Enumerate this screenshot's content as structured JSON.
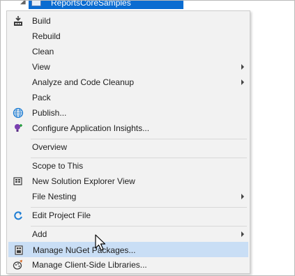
{
  "tree": {
    "selected_project_label": "ReportsCoreSamples"
  },
  "menu": {
    "items": [
      {
        "label": "Build",
        "icon": "build-icon",
        "submenu": false
      },
      {
        "label": "Rebuild",
        "icon": "",
        "submenu": false
      },
      {
        "label": "Clean",
        "icon": "",
        "submenu": false
      },
      {
        "label": "View",
        "icon": "",
        "submenu": true
      },
      {
        "label": "Analyze and Code Cleanup",
        "icon": "",
        "submenu": true
      },
      {
        "label": "Pack",
        "icon": "",
        "submenu": false
      },
      {
        "label": "Publish...",
        "icon": "globe-icon",
        "submenu": false
      },
      {
        "label": "Configure Application Insights...",
        "icon": "lightbulb-icon",
        "submenu": false
      },
      {
        "label": "Overview",
        "icon": "",
        "submenu": false
      },
      {
        "label": "Scope to This",
        "icon": "",
        "submenu": false
      },
      {
        "label": "New Solution Explorer View",
        "icon": "window-icon",
        "submenu": false
      },
      {
        "label": "File Nesting",
        "icon": "",
        "submenu": true
      },
      {
        "label": "Edit Project File",
        "icon": "edit-arrow-icon",
        "submenu": false
      },
      {
        "label": "Add",
        "icon": "",
        "submenu": true
      },
      {
        "label": "Manage NuGet Packages...",
        "icon": "nuget-package-icon",
        "submenu": false,
        "hovered": true
      },
      {
        "label": "Manage Client-Side Libraries...",
        "icon": "client-libraries-icon",
        "submenu": false
      }
    ]
  },
  "colors": {
    "menu_background": "#f2f2f2",
    "hover_highlight": "#c9def5",
    "selection_blue": "#0a6cd1"
  }
}
